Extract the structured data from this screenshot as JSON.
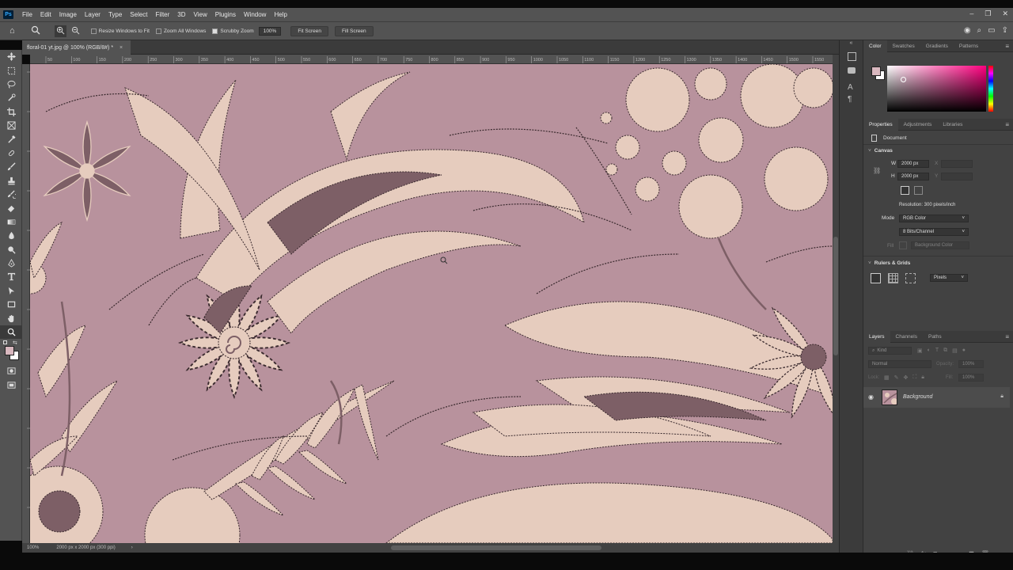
{
  "app_icon": "Ps",
  "menu": [
    "File",
    "Edit",
    "Image",
    "Layer",
    "Type",
    "Select",
    "Filter",
    "3D",
    "View",
    "Plugins",
    "Window",
    "Help"
  ],
  "window_controls": [
    "minimize",
    "restore",
    "close"
  ],
  "options": {
    "resize_windows": "Resize Windows to Fit",
    "zoom_all": "Zoom All Windows",
    "scrubby_zoom": "Scrubby Zoom",
    "zoom_value": "100%",
    "fit_screen": "Fit Screen",
    "fill_screen": "Fill Screen"
  },
  "document_tab": {
    "title": "floral-01 yt.jpg @ 100% (RGB/8#) *",
    "close": "×"
  },
  "ruler_labels": [
    "50",
    "100",
    "150",
    "200",
    "250",
    "300",
    "350",
    "400",
    "450",
    "500",
    "550",
    "600",
    "650",
    "700",
    "750",
    "800",
    "850",
    "900",
    "950",
    "1000",
    "1050",
    "1100",
    "1150",
    "1200",
    "1250",
    "1300",
    "1350",
    "1400",
    "1450",
    "1500",
    "1550"
  ],
  "status": {
    "zoom": "100%",
    "doc_info": "2000 px x 2000 px (300 ppi)",
    "arrow": "›"
  },
  "tools": [
    "move-icon",
    "marquee-icon",
    "lasso-icon",
    "quick-select-icon",
    "crop-icon",
    "frame-icon",
    "eyedropper-icon",
    "healing-icon",
    "brush-icon",
    "stamp-icon",
    "history-brush-icon",
    "eraser-icon",
    "gradient-icon",
    "blur-icon",
    "dodge-icon",
    "pen-icon",
    "type-icon",
    "path-select-icon",
    "rectangle-icon",
    "hand-icon",
    "zoom-icon"
  ],
  "color_panel": {
    "tabs": [
      "Color",
      "Swatches",
      "Gradients",
      "Patterns"
    ],
    "fg_color": "#d9b8bf",
    "bg_color": "#ffffff",
    "hue_color": "#ff0080"
  },
  "properties_panel": {
    "tabs": [
      "Properties",
      "Adjustments",
      "Libraries"
    ],
    "document_label": "Document",
    "canvas_title": "Canvas",
    "w_label": "W",
    "w_value": "2000 px",
    "h_label": "H",
    "h_value": "2000 px",
    "x_label": "X",
    "y_label": "Y",
    "resolution": "Resolution: 300 pixels/inch",
    "mode_label": "Mode",
    "mode_value": "RGB Color",
    "bits_value": "8 Bits/Channel",
    "fill_label": "Fill",
    "fill_value": "Background Color",
    "rulers_title": "Rulers & Grids",
    "units_value": "Pixels"
  },
  "layers_panel": {
    "tabs": [
      "Layers",
      "Channels",
      "Paths"
    ],
    "search_placeholder": "Kind",
    "blend_mode": "Normal",
    "opacity_label": "Opacity:",
    "opacity_value": "100%",
    "lock_label": "Lock:",
    "fill_label": "Fill:",
    "fill_value": "100%",
    "layer_name": "Background"
  },
  "colors": {
    "canvas_bg": "#b8929d",
    "motif_light": "#e6ccbe",
    "motif_dark": "#7d5f66"
  }
}
